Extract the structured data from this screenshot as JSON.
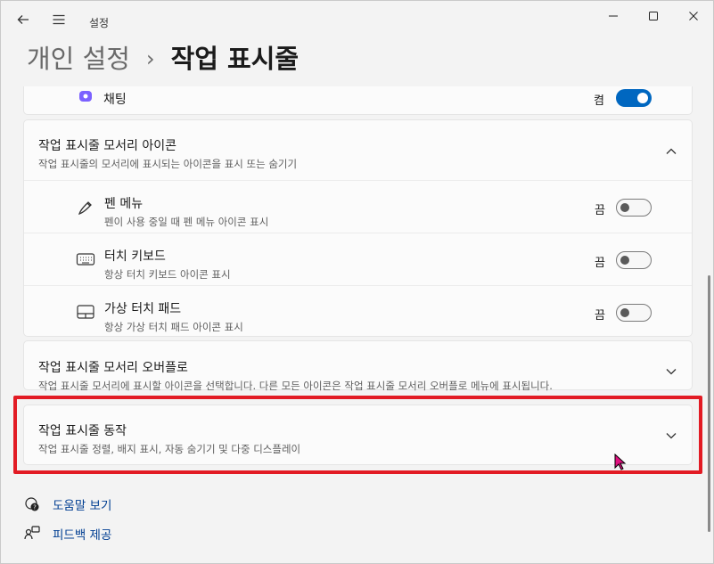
{
  "app": {
    "title": "설정"
  },
  "breadcrumb": {
    "parent": "개인 설정",
    "separator": "›",
    "current": "작업 표시줄"
  },
  "chat_row": {
    "label": "채팅",
    "state": "켬"
  },
  "overflow_icons_section": {
    "title": "작업 표시줄 모서리 아이콘",
    "desc": "작업 표시줄의 모서리에 표시되는 아이콘을 표시 또는 숨기기",
    "items": [
      {
        "label": "펜 메뉴",
        "desc": "펜이 사용 중일 때 펜 메뉴 아이콘 표시",
        "state": "끔",
        "icon": "pen-icon"
      },
      {
        "label": "터치 키보드",
        "desc": "항상 터치 키보드 아이콘 표시",
        "state": "끔",
        "icon": "keyboard-icon"
      },
      {
        "label": "가상 터치 패드",
        "desc": "항상 가상 터치 패드 아이콘 표시",
        "state": "끔",
        "icon": "touchpad-icon"
      }
    ]
  },
  "corner_overflow_section": {
    "title": "작업 표시줄 모서리 오버플로",
    "desc": "작업 표시줄 모서리에 표시할 아이콘을 선택합니다. 다른 모든 아이콘은 작업 표시줄 모서리 오버플로 메뉴에 표시됩니다."
  },
  "behaviors_section": {
    "title": "작업 표시줄 동작",
    "desc": "작업 표시줄 정렬, 배지 표시, 자동 숨기기 및 다중 디스플레이"
  },
  "footer": {
    "help": "도움말 보기",
    "feedback": "피드백 제공"
  },
  "colors": {
    "accent": "#0067c0",
    "highlight": "#e21b24",
    "link": "#003e92"
  }
}
